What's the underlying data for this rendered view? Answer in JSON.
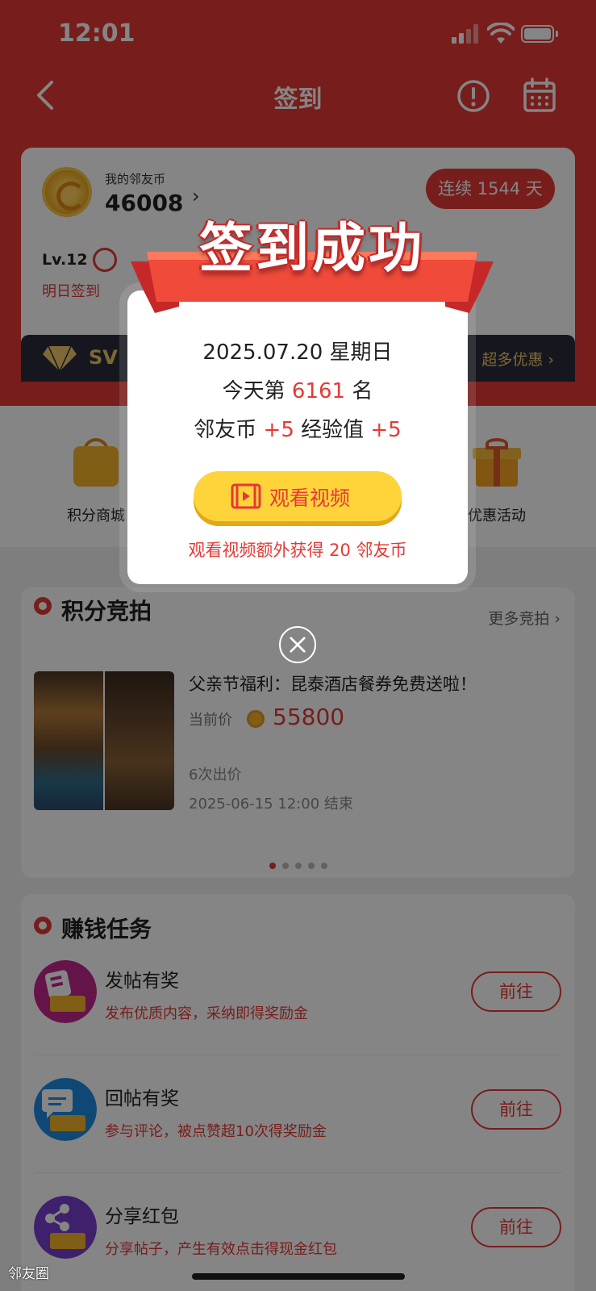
{
  "status_bar": {
    "time": "12:01"
  },
  "nav": {
    "title": "签到"
  },
  "coin_card": {
    "label": "我的邻友币",
    "value": "46008",
    "streak": "连续 1544 天",
    "level": "Lv.12",
    "tomorrow_text": "明日签到",
    "svip_text": "SV",
    "svip_more": "超多优惠 ›"
  },
  "quick_entries": [
    {
      "label": "积分商城",
      "icon": "shopping-bag-icon"
    },
    {
      "label": "优惠活动",
      "icon": "gift-icon"
    }
  ],
  "auction": {
    "title": "积分竞拍",
    "more": "更多竞拍 ›",
    "item_name": "父亲节福利：昆泰酒店餐券免费送啦！",
    "price_label": "当前价",
    "price": "55800",
    "bids": "6次出价",
    "end_time": "2025-06-15 12:00 结束",
    "page_count": 5,
    "active_page": 1
  },
  "tasks": {
    "title": "赚钱任务",
    "items": [
      {
        "title": "发帖有奖",
        "desc": "发布优质内容，采纳即得奖励金",
        "button": "前往"
      },
      {
        "title": "回帖有奖",
        "desc": "参与评论，被点赞超10次得奖励金",
        "button": "前往"
      },
      {
        "title": "分享红包",
        "desc": "分享帖子，产生有效点击得现金红包",
        "button": "前往"
      }
    ]
  },
  "modal": {
    "banner": "签到成功",
    "date": "2025.07.20 星期日",
    "rank_prefix": "今天第 ",
    "rank": "6161",
    "rank_suffix": " 名",
    "coin_label": "邻友币 ",
    "coin_plus": "+5",
    "exp_label": " 经验值 ",
    "exp_plus": "+5",
    "watch_button": "观看视频",
    "tip": "观看视频额外获得 20 邻友币"
  },
  "watermark": "邻友圈",
  "colors": {
    "brand_red": "#e53935",
    "gold": "#ffd43b"
  }
}
